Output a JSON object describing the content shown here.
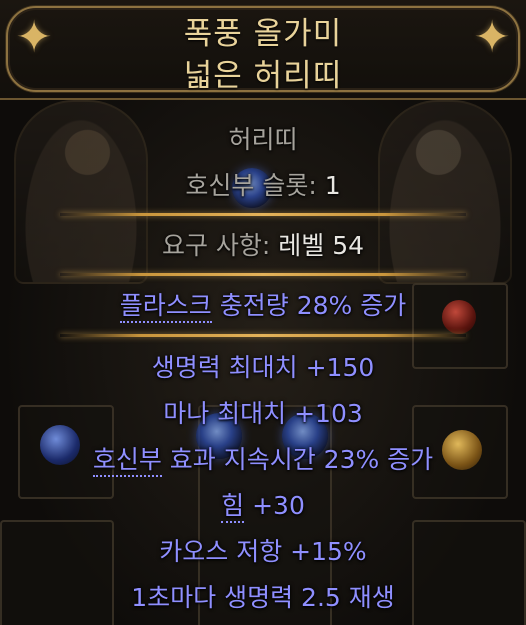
{
  "header": {
    "title_line1": "폭풍 올가미",
    "title_line2": "넓은 허리띠",
    "ornament_glyph": "✦"
  },
  "item": {
    "base_type": "허리띠",
    "charm_slots_label": "호신부 슬롯:",
    "charm_slots_value": "1",
    "requirement_label": "요구 사항:",
    "requirement_value": "레벨 54",
    "implicit": {
      "prefix": "플라스크",
      "rest": " 충전량 28% 증가"
    },
    "mods": {
      "life": "생명력 최대치 +150",
      "mana": "마나 최대치 +103",
      "charm_prefix": "호신부",
      "charm_rest": " 효과 지속시간 23% 증가",
      "str_prefix": "힘",
      "str_rest": " +30",
      "chaos": "카오스 저항 +15%",
      "regen": "1초마다 생명력 2.5 재생"
    }
  },
  "colors": {
    "title": "#e9d39a",
    "base_text": "#a6a39c",
    "value_text": "#e8e6e1",
    "magic_text": "#8f8fff",
    "separator": "#e3b25a"
  }
}
